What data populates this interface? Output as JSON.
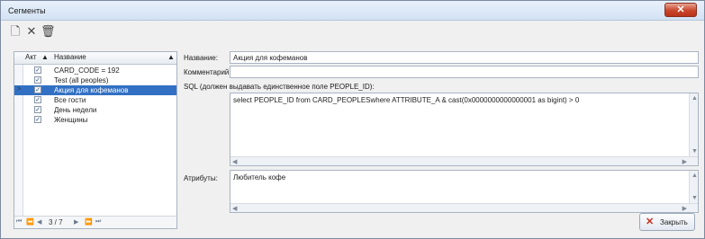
{
  "window": {
    "title": "Сегменты",
    "close_glyph": "✕"
  },
  "toolbar": {
    "icons": [
      "new-doc-icon",
      "delete-icon",
      "trash-icon"
    ],
    "glyphs": {
      "new": "🗋",
      "delete": "✕",
      "trash": "🗑"
    }
  },
  "grid": {
    "headers": {
      "active": "Акт≤ ▲",
      "name": "Название",
      "sort": "▲"
    },
    "rows": [
      {
        "active": true,
        "name": "CARD_CODE = 192"
      },
      {
        "active": true,
        "name": "Test (all peoples)"
      },
      {
        "active": true,
        "name": "Акция для кофеманов",
        "selected": true
      },
      {
        "active": true,
        "name": "Все гости"
      },
      {
        "active": true,
        "name": "День недели"
      },
      {
        "active": true,
        "name": "Женщины"
      }
    ],
    "row_indicator": ">",
    "pager": {
      "text": "3 / 7",
      "first": "⏮",
      "prev_page": "⏪",
      "prev": "◀",
      "next": "▶",
      "next_page": "⏩",
      "last": "⏭"
    }
  },
  "form": {
    "name_label": "Название:",
    "name_value": "Акция для кофеманов",
    "comment_label": "Комментарий",
    "comment_value": "",
    "sql_label": "SQL (должен выдавать единственное поле PEOPLE_ID):",
    "sql_value": "select PEOPLE_ID from CARD_PEOPLESwhere ATTRIBUTE_A & cast(0x0000000000000001 as bigint) > 0",
    "attributes_label": "Атрибуты:",
    "attributes_value": "Любитель кофе"
  },
  "footer": {
    "close_label": "Закрыть"
  },
  "colors": {
    "accent": "#3270c4",
    "close": "#c9452a"
  }
}
